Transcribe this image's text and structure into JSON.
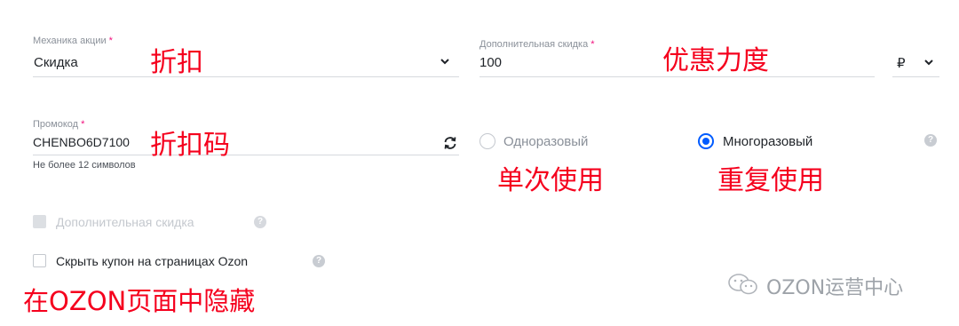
{
  "mechanics": {
    "label": "Механика акции",
    "required_mark": "*",
    "value": "Скидка",
    "annotation": "折扣"
  },
  "extra_discount": {
    "label": "Дополнительная скидка",
    "required_mark": "*",
    "value": "100",
    "annotation": "优惠力度",
    "currency": "₽"
  },
  "promocode": {
    "label": "Промокод",
    "required_mark": "*",
    "value": "CHENBO6D7100",
    "annotation": "折扣码",
    "hint": "Не более 12 символов"
  },
  "usage": {
    "options": [
      {
        "label": "Одноразовый",
        "selected": false,
        "annotation": "单次使用"
      },
      {
        "label": "Многоразовый",
        "selected": true,
        "annotation": "重复使用"
      }
    ]
  },
  "checkboxes": {
    "extra_discount": {
      "label": "Дополнительная скидка",
      "checked": false,
      "disabled": true
    },
    "hide_coupon": {
      "label": "Скрыть купон на страницах Ozon",
      "checked": false,
      "annotation": "在OZON页面中隐藏"
    }
  },
  "help_glyph": "?",
  "watermark": {
    "text": "OZON运营中心",
    "icon": "wechat-icon"
  },
  "colors": {
    "accent": "#005bff",
    "required": "#f1117e",
    "annotation": "#f5001d"
  }
}
